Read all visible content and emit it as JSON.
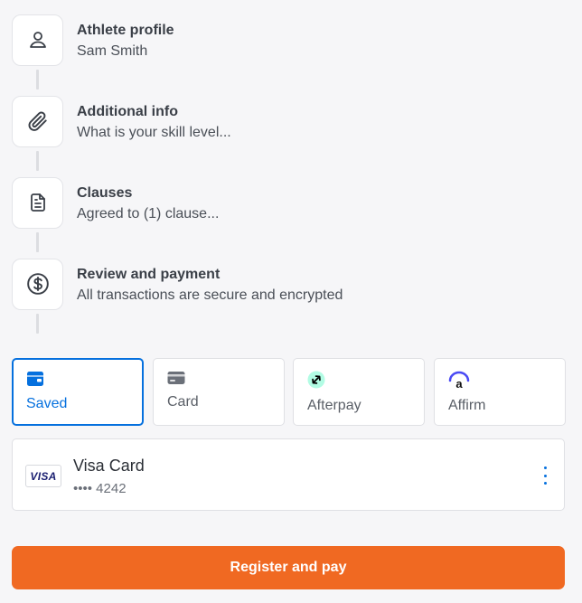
{
  "steps": [
    {
      "title": "Athlete profile",
      "subtitle": "Sam Smith",
      "icon": "user-icon"
    },
    {
      "title": "Additional info",
      "subtitle": "What is your skill level...",
      "icon": "paperclip-icon"
    },
    {
      "title": "Clauses",
      "subtitle": "Agreed to (1) clause...",
      "icon": "document-icon"
    },
    {
      "title": "Review and payment",
      "subtitle": "All transactions are secure and encrypted",
      "icon": "dollar-circle-icon"
    }
  ],
  "payment_methods": [
    {
      "label": "Saved",
      "icon": "wallet-icon",
      "selected": true
    },
    {
      "label": "Card",
      "icon": "card-icon",
      "selected": false
    },
    {
      "label": "Afterpay",
      "icon": "afterpay-icon",
      "selected": false
    },
    {
      "label": "Affirm",
      "icon": "affirm-icon",
      "selected": false
    }
  ],
  "saved_card": {
    "brand_logo": "VISA",
    "name": "Visa Card",
    "number": "•••• 4242"
  },
  "submit": {
    "label": "Register and pay"
  },
  "colors": {
    "accent": "#0570de",
    "button": "#f06922",
    "background": "#f6f6f8",
    "afterpay_mint": "#b2fce4"
  }
}
